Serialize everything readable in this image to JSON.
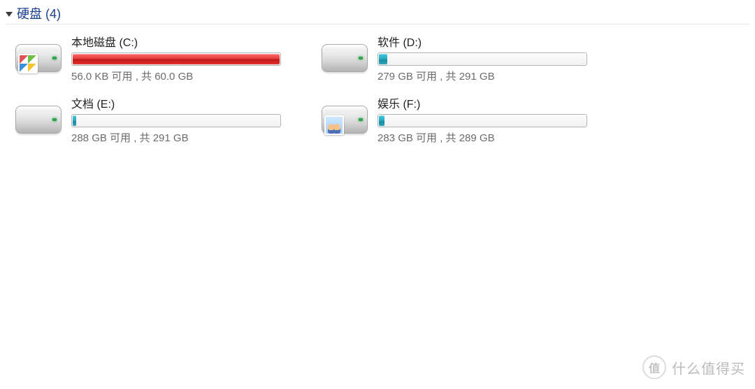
{
  "section": {
    "title": "硬盘 (4)"
  },
  "drives": [
    {
      "name": "本地磁盘 (C:)",
      "status": "56.0 KB 可用 , 共 60.0 GB",
      "fill_percent": 99.9,
      "fill_color": "red",
      "overlay": "windows"
    },
    {
      "name": "软件 (D:)",
      "status": "279 GB 可用 , 共 291 GB",
      "fill_percent": 4.1,
      "fill_color": "teal",
      "overlay": "none"
    },
    {
      "name": "文档 (E:)",
      "status": "288 GB 可用 , 共 291 GB",
      "fill_percent": 1.0,
      "fill_color": "teal",
      "overlay": "none"
    },
    {
      "name": "娱乐 (F:)",
      "status": "283 GB 可用 , 共 289 GB",
      "fill_percent": 2.1,
      "fill_color": "teal",
      "overlay": "people"
    }
  ],
  "watermark": {
    "badge": "值",
    "text": "什么值得买"
  }
}
